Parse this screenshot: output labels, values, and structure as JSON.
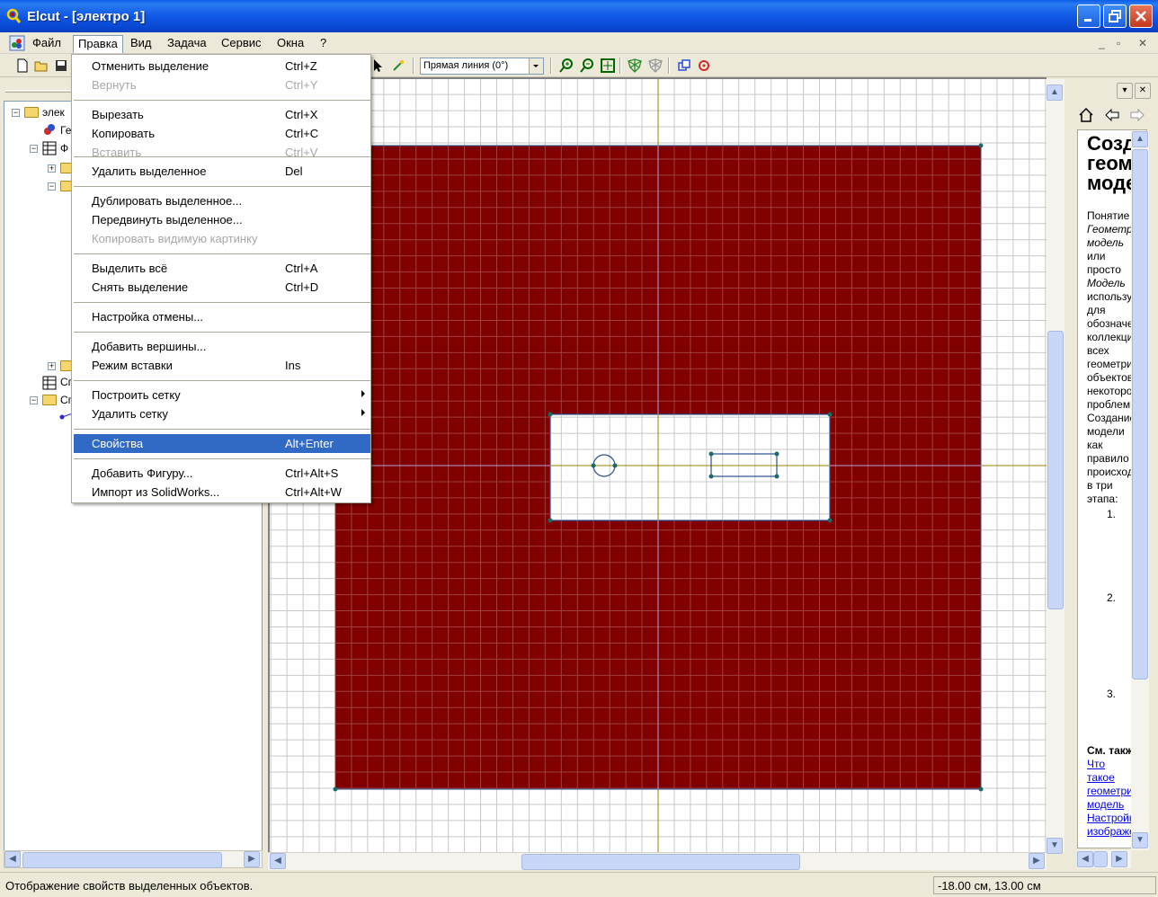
{
  "window": {
    "title": "Elcut - [электро 1]"
  },
  "menubar": {
    "items": [
      "Файл",
      "Правка",
      "Вид",
      "Задача",
      "Сервис",
      "Окна",
      "?"
    ],
    "active": "Правка"
  },
  "toolbar": {
    "line_type": "Прямая линия (0°)"
  },
  "edit_menu": {
    "items": [
      {
        "label": "Отменить выделение",
        "shortcut": "Ctrl+Z",
        "disabled": false
      },
      {
        "label": "Вернуть",
        "shortcut": "Ctrl+Y",
        "disabled": true
      },
      {
        "label": "Вырезать",
        "shortcut": "Ctrl+X",
        "disabled": false
      },
      {
        "label": "Копировать",
        "shortcut": "Ctrl+C",
        "disabled": false
      },
      {
        "label": "Вставить",
        "shortcut": "Ctrl+V",
        "disabled": true
      },
      {
        "label": "Удалить выделенное",
        "shortcut": "Del",
        "disabled": false
      },
      {
        "label": "Дублировать выделенное...",
        "shortcut": "",
        "disabled": false
      },
      {
        "label": "Передвинуть выделенное...",
        "shortcut": "",
        "disabled": false
      },
      {
        "label": "Копировать видимую картинку",
        "shortcut": "",
        "disabled": true
      },
      {
        "label": "Выделить всё",
        "shortcut": "Ctrl+A",
        "disabled": false
      },
      {
        "label": "Снять выделение",
        "shortcut": "Ctrl+D",
        "disabled": false
      },
      {
        "label": "Настройка отмены...",
        "shortcut": "",
        "disabled": false
      },
      {
        "label": "Добавить вершины...",
        "shortcut": "",
        "disabled": false
      },
      {
        "label": "Режим вставки",
        "shortcut": "Ins",
        "disabled": false
      },
      {
        "label": "Построить сетку",
        "shortcut": "",
        "disabled": false,
        "submenu": true
      },
      {
        "label": "Удалить сетку",
        "shortcut": "",
        "disabled": false,
        "submenu": true
      },
      {
        "label": "Свойства",
        "shortcut": "Alt+Enter",
        "disabled": false,
        "highlighted": true
      },
      {
        "label": "Добавить Фигуру...",
        "shortcut": "Ctrl+Alt+S",
        "disabled": false
      },
      {
        "label": "Импорт из SolidWorks...",
        "shortcut": "Ctrl+Alt+W",
        "disabled": false
      }
    ]
  },
  "tree": {
    "root_label": "элек",
    "items": [
      "Ге",
      "Ф",
      "Сп",
      "Сп"
    ]
  },
  "help": {
    "heading": "Создание геометрической модели",
    "body": [
      "Понятие",
      "Геометрическая",
      "модель",
      "или",
      "просто",
      "Модель",
      "используется",
      "для",
      "обозначения",
      "коллекции",
      "всех",
      "геометрических",
      "объектов",
      "некоторой",
      "проблемы.",
      "Создание",
      "модели",
      "как",
      "правило",
      "происходит",
      "в три",
      "этапа:"
    ],
    "steps": [
      "1.",
      "2.",
      "3."
    ],
    "see_also": "См. также:",
    "links": [
      "Что",
      "такое",
      "геометрическая",
      "модель",
      "Настройка",
      "изображения"
    ]
  },
  "status": {
    "text": "Отображение свойств выделенных объектов.",
    "coords": "-18.00 см, 13.00 см"
  },
  "colors": {
    "region_fill": "#800000",
    "grid_line": "#c8c8c8",
    "axis_line": "#a08000",
    "highlight": "#316ac5"
  }
}
